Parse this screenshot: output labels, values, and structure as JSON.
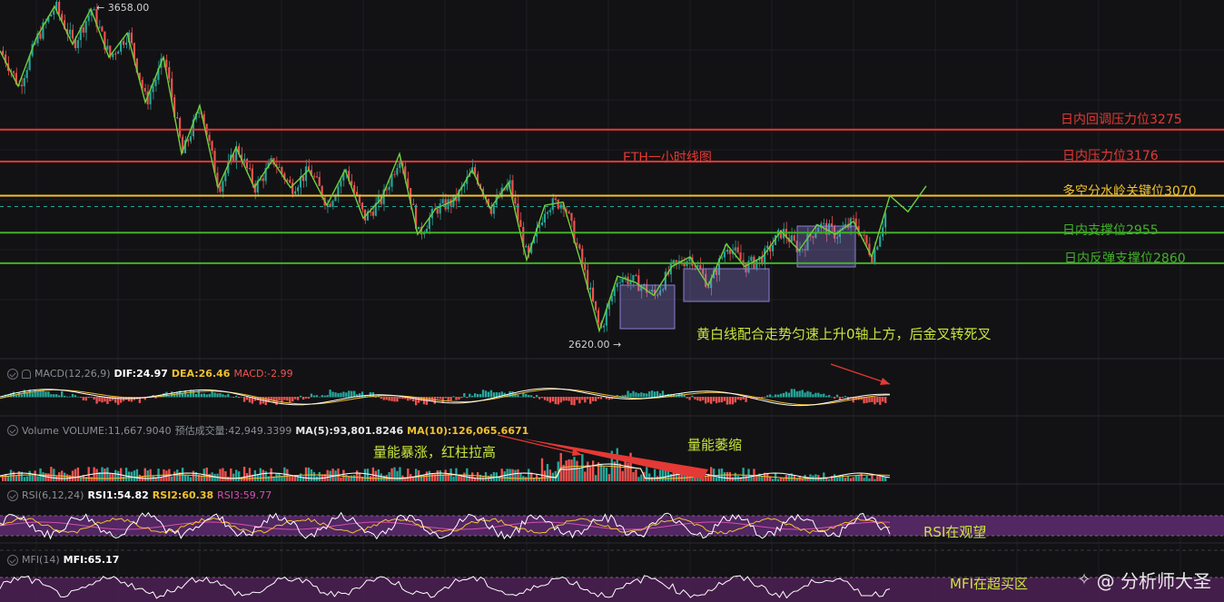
{
  "chart_data": [
    {
      "type": "candlestick",
      "title": "ETH一小时线图",
      "ylim": [
        2600,
        3680
      ],
      "high_label": "3658.00",
      "low_label": "2620.00",
      "levels": [
        {
          "name": "日内回调压力位3275",
          "value": 3275,
          "color": "#e53935"
        },
        {
          "name": "日内压力位3176",
          "value": 3176,
          "color": "#e53935"
        },
        {
          "name": "多空分水岭关键位3070",
          "value": 3070,
          "color": "#f2c12e"
        },
        {
          "name": "日内支撑位2955",
          "value": 2955,
          "color": "#43b02a"
        },
        {
          "name": "日内反弹支撑位2860",
          "value": 2860,
          "color": "#43b02a"
        }
      ],
      "current_price": 3036,
      "wave_path": [
        3520,
        3410,
        3560,
        3658,
        3540,
        3650,
        3500,
        3575,
        3360,
        3500,
        3200,
        3350,
        3095,
        3220,
        3095,
        3180,
        3095,
        3150,
        3040,
        3150,
        3000,
        3060,
        3200,
        2950,
        3030,
        3055,
        3150,
        3030,
        3110,
        2870,
        3040,
        3050,
        2860,
        2650,
        2820,
        2800,
        2760,
        2850,
        2880,
        2790,
        2920,
        2850,
        2880,
        2960,
        2900,
        2980,
        2950,
        2990,
        2880,
        3070,
        3020,
        3100
      ],
      "annotations": [
        "黄白线配合走势匀速上升0轴上方，后金叉转死叉"
      ]
    },
    {
      "type": "line",
      "title": "MACD(12,26,9)",
      "stats": {
        "dif": "DIF:24.97",
        "dea": "DEA:26.46",
        "macd": "MACD:-2.99"
      }
    },
    {
      "type": "bar",
      "title": "Volume",
      "stats": {
        "volume": "VOLUME:11,667.9040",
        "pred": "预估成交量:42,949.3399",
        "ma5": "MA(5):93,801.8246",
        "ma10": "MA(10):126,065.6671"
      },
      "annotations": [
        "量能暴涨，红柱拉高",
        "量能萎缩"
      ]
    },
    {
      "type": "line",
      "title": "RSI(6,12,24)",
      "stats": {
        "rsi1": "RSI1:54.82",
        "rsi2": "RSI2:60.38",
        "rsi3": "RSI3:59.77"
      },
      "annotations": [
        "RSI在观望"
      ]
    },
    {
      "type": "line",
      "title": "MFI(14)",
      "stats": {
        "mfi": "MFI:65.17"
      },
      "annotations": [
        "MFI在超买区"
      ]
    }
  ],
  "watermark": {
    "icon": "diamond-logo-icon",
    "text": "@ 分析师大圣"
  },
  "colors": {
    "up": "#26a69a",
    "down": "#ef5350",
    "wave": "#6fcf3b",
    "box": "#8b7fd4",
    "dif": "#ffffff",
    "dea": "#f2c12e",
    "rsi_band": "#5a2a6a",
    "mfi_band": "#4a2050"
  }
}
